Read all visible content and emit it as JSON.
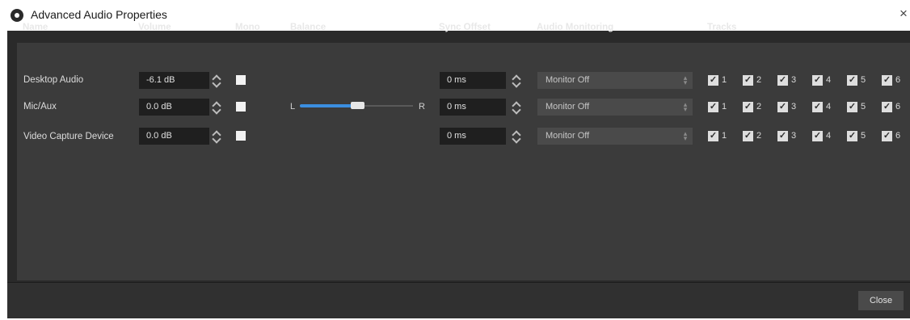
{
  "window": {
    "title": "Advanced Audio Properties",
    "close_glyph": "×"
  },
  "columns": {
    "name": "Name",
    "volume": "Volume",
    "mono": "Mono",
    "balance": "Balance",
    "sync_offset": "Sync Offset",
    "audio_monitoring": "Audio Monitoring",
    "tracks": "Tracks"
  },
  "rows": [
    {
      "name": "Desktop Audio",
      "volume": "-6.1 dB",
      "mono": false,
      "sync_offset": "0 ms",
      "monitoring": "Monitor Off",
      "tracks": [
        "1",
        "2",
        "3",
        "4",
        "5",
        "6"
      ]
    },
    {
      "name": "Mic/Aux",
      "volume": "0.0 dB",
      "mono": false,
      "sync_offset": "0 ms",
      "monitoring": "Monitor Off",
      "tracks": [
        "1",
        "2",
        "3",
        "4",
        "5",
        "6"
      ]
    },
    {
      "name": "Video Capture Device",
      "volume": "0.0 dB",
      "mono": false,
      "sync_offset": "0 ms",
      "monitoring": "Monitor Off",
      "tracks": [
        "1",
        "2",
        "3",
        "4",
        "5",
        "6"
      ]
    }
  ],
  "balance": {
    "left_label": "L",
    "right_label": "R",
    "value_fraction": 0.47
  },
  "footer": {
    "close_label": "Close"
  },
  "colors": {
    "background": "#2a2a2a",
    "panel": "#3b3b3b",
    "accent": "#3b8ee0"
  }
}
